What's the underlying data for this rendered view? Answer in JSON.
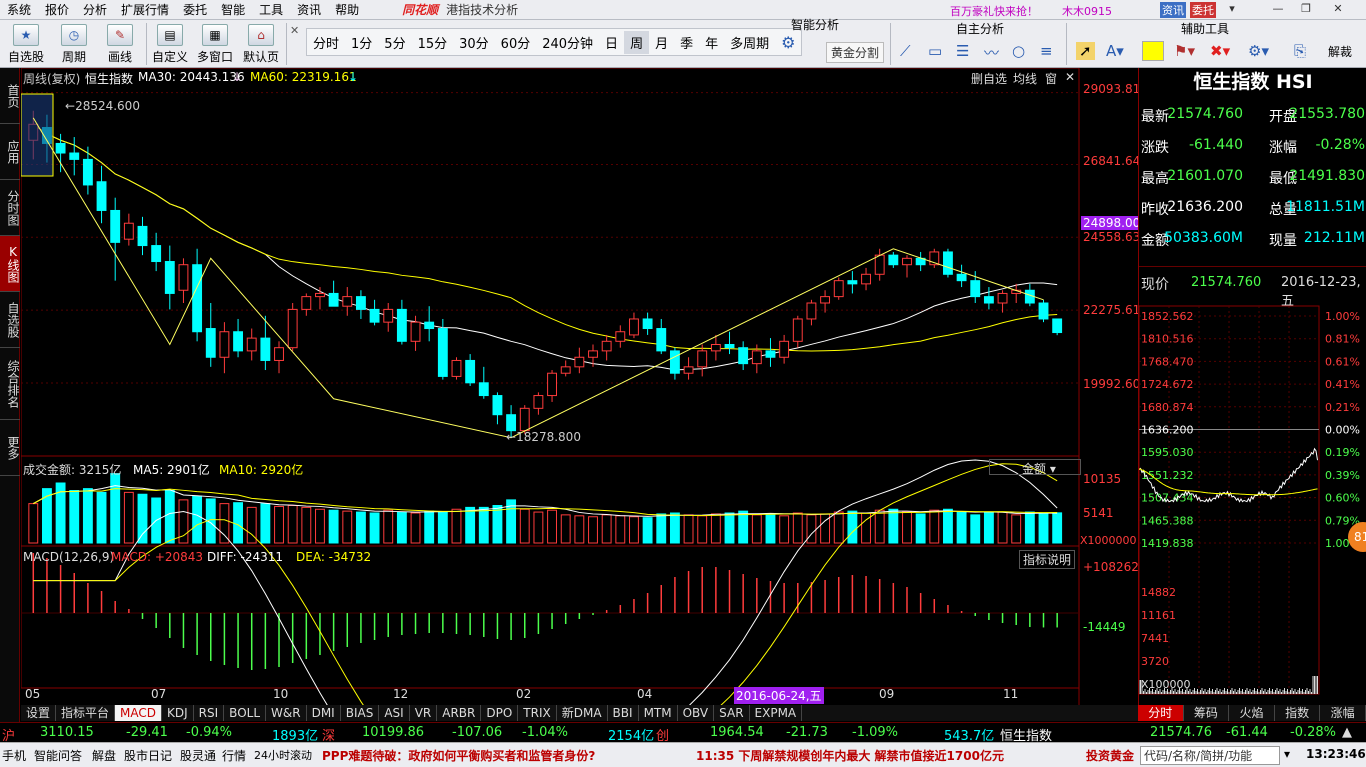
{
  "menu": {
    "items": [
      "系统",
      "报价",
      "分析",
      "扩展行情",
      "委托",
      "智能",
      "工具",
      "资讯",
      "帮助"
    ],
    "brand": "同花顺",
    "title": "港指技术分析",
    "promo": "百万豪礼快来抢！",
    "user": "木木0915"
  },
  "toolbar": {
    "left": [
      "自选股",
      "周期",
      "画线",
      "自定义",
      "多窗口",
      "默认页"
    ],
    "periods": [
      "分时",
      "1分",
      "5分",
      "15分",
      "30分",
      "60分",
      "240分钟",
      "日",
      "周",
      "月",
      "季",
      "年",
      "多周期"
    ],
    "active_period": "周",
    "goldsplit": "黄金分割",
    "sections": [
      "智能分析",
      "自主分析",
      "辅助工具"
    ],
    "right_btn": "解裁",
    "top_btns": [
      "资讯",
      "委托"
    ]
  },
  "leftnav": [
    {
      "label": "首页",
      "active": false
    },
    {
      "label": "应用",
      "active": false
    },
    {
      "label": "分时图",
      "active": false
    },
    {
      "label": "K线图",
      "active": true
    },
    {
      "label": "自选股",
      "active": false
    },
    {
      "label": "综合排名",
      "active": false
    },
    {
      "label": "更多",
      "active": false
    }
  ],
  "kpanel": {
    "title_period": "周线(复权)",
    "title_name": "恒生指数",
    "ma30_label": "MA30: 20443.136",
    "ma60_label": "MA60: 22319.161",
    "btns": [
      "删自选",
      "均线",
      "窗"
    ],
    "high_label": "28524.600",
    "low_label": "18278.800",
    "yticks": [
      "29093.81",
      "26841.64",
      "24558.63",
      "22275.61",
      "19992.60"
    ],
    "current_tag": "24898.00"
  },
  "vpanel": {
    "label": "成交金额: 3215亿",
    "ma5": "MA5: 2901亿",
    "ma10": "MA10: 2920亿",
    "selector": "金额",
    "yticks": [
      "10135",
      "5141",
      "X1000000"
    ]
  },
  "mpanel": {
    "label": "MACD(12,26,9)",
    "macd": "MACD: +20843",
    "diff": "DIFF: -24311",
    "dea": "DEA: -34732",
    "btn": "指标说明",
    "yticks": [
      "+108262",
      "-14449"
    ]
  },
  "xaxis": {
    "labels": [
      "05",
      "07",
      "10",
      "12",
      "02",
      "04",
      "09",
      "11"
    ],
    "highlight": "2016-06-24,五"
  },
  "bottom_tabs": [
    "设置",
    "指标平台",
    "MACD",
    "KDJ",
    "RSI",
    "BOLL",
    "W&R",
    "DMI",
    "BIAS",
    "ASI",
    "VR",
    "ARBR",
    "DPO",
    "TRIX",
    "新DMA",
    "BBI",
    "MTM",
    "OBV",
    "SAR",
    "EXPMA"
  ],
  "active_tab": "MACD",
  "quote": {
    "name": "恒生指数 HSI",
    "rows": [
      {
        "l1": "最新",
        "v1": "21574.760",
        "l2": "开盘",
        "v2": "21553.780",
        "c1": "grn",
        "c2": "grn"
      },
      {
        "l1": "涨跌",
        "v1": "-61.440",
        "l2": "涨幅",
        "v2": "-0.28%",
        "c1": "grn",
        "c2": "grn"
      },
      {
        "l1": "最高",
        "v1": "21601.070",
        "l2": "最低",
        "v2": "21491.830",
        "c1": "grn",
        "c2": "grn"
      },
      {
        "l1": "昨收",
        "v1": "21636.200",
        "l2": "总量",
        "v2": "11811.51M",
        "c1": "wht",
        "c2": "cyn"
      },
      {
        "l1": "金额",
        "v1": "50383.60M",
        "l2": "现量",
        "v2": "212.11M",
        "c1": "cyn",
        "c2": "cyn"
      }
    ],
    "now_label": "现价",
    "now_value": "21574.760",
    "date": "2016-12-23,五"
  },
  "mini": {
    "yticks": [
      "1852.562",
      "1810.516",
      "1768.470",
      "1724.672",
      "1680.874",
      "1636.200",
      "1595.030",
      "1551.232",
      "1507.434",
      "1465.388",
      "1419.838"
    ],
    "pticks": [
      "1.00%",
      "0.81%",
      "0.61%",
      "0.41%",
      "0.21%",
      "0.00%",
      "0.19%",
      "0.39%",
      "0.60%",
      "0.79%",
      "1.00%"
    ],
    "vticks": [
      "14882",
      "11161",
      "7441",
      "3720",
      "X100000"
    ]
  },
  "right_tabs": [
    "分时",
    "筹码",
    "火焰",
    "指数",
    "涨幅"
  ],
  "indexbar": {
    "sh": "沪",
    "sh_val": "3110.15",
    "sh_chg": "-29.41",
    "sh_pct": "-0.94%",
    "sh_amt": "1893亿",
    "sz": "深",
    "sz_val": "10199.86",
    "sz_chg": "-107.06",
    "sz_pct": "-1.04%",
    "sz_amt": "2154亿",
    "cy": "创",
    "cy_val": "1964.54",
    "cy_chg": "-21.73",
    "cy_pct": "-1.09%",
    "cy_amt": "543.7亿",
    "hs": "恒生指数",
    "hs_val": "21574.76",
    "hs_chg": "-61.44",
    "hs_pct": "-0.28%"
  },
  "status": {
    "items": [
      "手机",
      "智能问答",
      "解盘",
      "股市日记",
      "股灵通",
      "行情",
      "24小时滚动"
    ],
    "news1": "PPP难题待破：政府如何平衡购买者和监管者身份?",
    "news2": "11:35 下周解禁规模创年内最大 解禁市值接近1700亿元",
    "ad": "投资黄金",
    "search": "代码/名称/简拼/功能",
    "time": "13:23:46"
  },
  "chart_data": {
    "type": "candlestick",
    "period": "weekly",
    "series_name": "恒生指数",
    "marked_high": 28524.6,
    "marked_low": 18278.8,
    "candles": [
      [
        27600,
        28524.6,
        27000,
        28100
      ],
      [
        28000,
        28400,
        26900,
        27500
      ],
      [
        27500,
        27800,
        26600,
        27200
      ],
      [
        27200,
        27700,
        26500,
        27000
      ],
      [
        27000,
        27400,
        25900,
        26200
      ],
      [
        26300,
        26800,
        25000,
        25400
      ],
      [
        25400,
        25800,
        23200,
        24400
      ],
      [
        24500,
        25300,
        24300,
        25000
      ],
      [
        24900,
        25200,
        24000,
        24300
      ],
      [
        24300,
        24700,
        23500,
        23800
      ],
      [
        23800,
        24300,
        22300,
        22800
      ],
      [
        22900,
        23900,
        22500,
        23700
      ],
      [
        23700,
        24200,
        21300,
        21600
      ],
      [
        21700,
        22500,
        20500,
        20800
      ],
      [
        20800,
        21900,
        20300,
        21600
      ],
      [
        21600,
        22000,
        20800,
        21000
      ],
      [
        21000,
        21700,
        20700,
        21400
      ],
      [
        21400,
        22100,
        20400,
        20700
      ],
      [
        20700,
        21300,
        20300,
        21100
      ],
      [
        21100,
        22500,
        21000,
        22300
      ],
      [
        22300,
        22800,
        22100,
        22700
      ],
      [
        22700,
        23000,
        22300,
        22800
      ],
      [
        22800,
        23200,
        22400,
        22400
      ],
      [
        22400,
        23000,
        22100,
        22700
      ],
      [
        22700,
        22900,
        22000,
        22300
      ],
      [
        22300,
        22600,
        21800,
        21900
      ],
      [
        21900,
        22500,
        21600,
        22300
      ],
      [
        22300,
        22600,
        21200,
        21300
      ],
      [
        21300,
        22100,
        21000,
        21900
      ],
      [
        21900,
        22400,
        21300,
        21700
      ],
      [
        21700,
        22000,
        20100,
        20200
      ],
      [
        20200,
        20800,
        20100,
        20700
      ],
      [
        20700,
        20900,
        19900,
        20000
      ],
      [
        20000,
        20500,
        19500,
        19600
      ],
      [
        19600,
        19700,
        18700,
        19000
      ],
      [
        19000,
        19300,
        18278.8,
        18500
      ],
      [
        18500,
        19300,
        18400,
        19200
      ],
      [
        19200,
        19700,
        19000,
        19600
      ],
      [
        19600,
        20400,
        19400,
        20300
      ],
      [
        20300,
        20700,
        20200,
        20500
      ],
      [
        20500,
        21100,
        20300,
        20800
      ],
      [
        20800,
        21200,
        20500,
        21000
      ],
      [
        21000,
        21500,
        20700,
        21300
      ],
      [
        21300,
        21800,
        21100,
        21600
      ],
      [
        21500,
        22200,
        21400,
        22000
      ],
      [
        22000,
        22200,
        21500,
        21700
      ],
      [
        21700,
        22000,
        20900,
        21000
      ],
      [
        21000,
        21100,
        20100,
        20300
      ],
      [
        20300,
        20800,
        20100,
        20500
      ],
      [
        20500,
        21200,
        20200,
        21000
      ],
      [
        21000,
        21500,
        20700,
        21200
      ],
      [
        21200,
        21600,
        20900,
        21100
      ],
      [
        21100,
        21300,
        20400,
        20600
      ],
      [
        20600,
        21200,
        20300,
        21000
      ],
      [
        21000,
        21400,
        20500,
        20800
      ],
      [
        20800,
        21500,
        20600,
        21300
      ],
      [
        21300,
        22100,
        21100,
        22000
      ],
      [
        22000,
        22600,
        21800,
        22500
      ],
      [
        22500,
        22900,
        22200,
        22700
      ],
      [
        22700,
        23300,
        22600,
        23200
      ],
      [
        23200,
        23500,
        22800,
        23100
      ],
      [
        23100,
        23600,
        22900,
        23400
      ],
      [
        23400,
        24200,
        23200,
        24000
      ],
      [
        24000,
        24100,
        23600,
        23700
      ],
      [
        23700,
        24000,
        23300,
        23900
      ],
      [
        23900,
        24100,
        23500,
        23700
      ],
      [
        23700,
        24200,
        23600,
        24100
      ],
      [
        24100,
        24200,
        23300,
        23400
      ],
      [
        23400,
        23700,
        23000,
        23200
      ],
      [
        23200,
        23500,
        22500,
        22700
      ],
      [
        22700,
        23000,
        22300,
        22500
      ],
      [
        22500,
        22900,
        22200,
        22800
      ],
      [
        22800,
        23100,
        22500,
        22900
      ],
      [
        22900,
        23100,
        22400,
        22500
      ],
      [
        22500,
        22600,
        21900,
        22000
      ],
      [
        22000,
        22000,
        21491.8,
        21574.8
      ]
    ],
    "ma30_last": 20443.136,
    "ma60_last": 22319.161,
    "volume": [
      4200,
      5800,
      6400,
      5600,
      5800,
      5400,
      7400,
      5400,
      5200,
      4800,
      5600,
      4600,
      5000,
      4700,
      4200,
      4300,
      3800,
      4200,
      3900,
      4000,
      3800,
      3600,
      3500,
      3400,
      3300,
      3200,
      3500,
      3300,
      3200,
      3400,
      3300,
      3600,
      3800,
      3800,
      4000,
      4600,
      3600,
      3300,
      3500,
      3000,
      2900,
      2800,
      3000,
      2900,
      2800,
      2700,
      3100,
      3200,
      3000,
      2900,
      3100,
      3200,
      3400,
      3000,
      3100,
      2900,
      3200,
      3000,
      3100,
      3300,
      3400,
      3200,
      3500,
      3600,
      3300,
      3100,
      3500,
      3600,
      3300,
      3000,
      3200,
      3300,
      3000,
      3300,
      3100,
      3215
    ],
    "macd_hist": [
      60000,
      55000,
      48000,
      40000,
      30000,
      22000,
      12000,
      4000,
      -6000,
      -15000,
      -25000,
      -35000,
      -42000,
      -48000,
      -52000,
      -55000,
      -57000,
      -56000,
      -54000,
      -50000,
      -46000,
      -42000,
      -38000,
      -34000,
      -30000,
      -27000,
      -24000,
      -22000,
      -21000,
      -20000,
      -20000,
      -21000,
      -22000,
      -24000,
      -26000,
      -27000,
      -25000,
      -21000,
      -16000,
      -11000,
      -6000,
      -2000,
      3000,
      8000,
      14000,
      20000,
      28000,
      36000,
      42000,
      46000,
      46000,
      43000,
      39000,
      35000,
      32000,
      30000,
      30000,
      31000,
      33000,
      36000,
      38000,
      37000,
      34000,
      30000,
      26000,
      20000,
      14000,
      8000,
      2000,
      -3000,
      -7000,
      -10000,
      -12000,
      -14000,
      -14449,
      -14449
    ],
    "diff_last": -24311,
    "dea_last": -34732,
    "macd_last": 20843,
    "x_tick_labels": [
      "05",
      "07",
      "10",
      "12",
      "02",
      "04",
      "09",
      "11"
    ],
    "y_ticks": [
      29093.81,
      26841.64,
      24558.63,
      22275.61,
      19992.6
    ],
    "intraday_ref": 21636.2
  }
}
